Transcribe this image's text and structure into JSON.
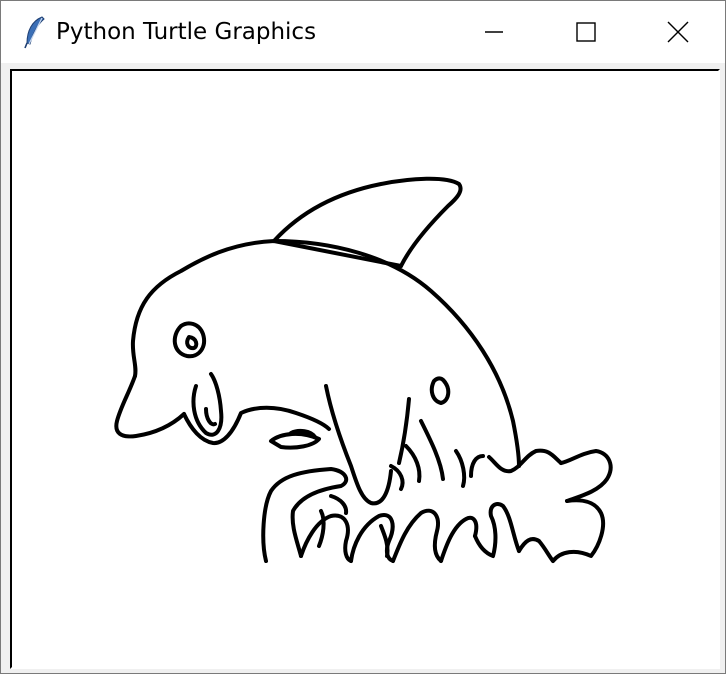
{
  "window": {
    "title": "Python Turtle Graphics"
  },
  "icons": {
    "app": "feather-icon",
    "minimize": "minimize-icon",
    "maximize": "maximize-icon",
    "close": "close-icon"
  },
  "canvas": {
    "background": "#ffffff",
    "drawing": "dolphin-line-drawing",
    "stroke_color": "#000000"
  },
  "colors": {
    "titlebar": "#ffffff",
    "window_background": "#f0f0f0",
    "feather": "#3b6fb6"
  }
}
